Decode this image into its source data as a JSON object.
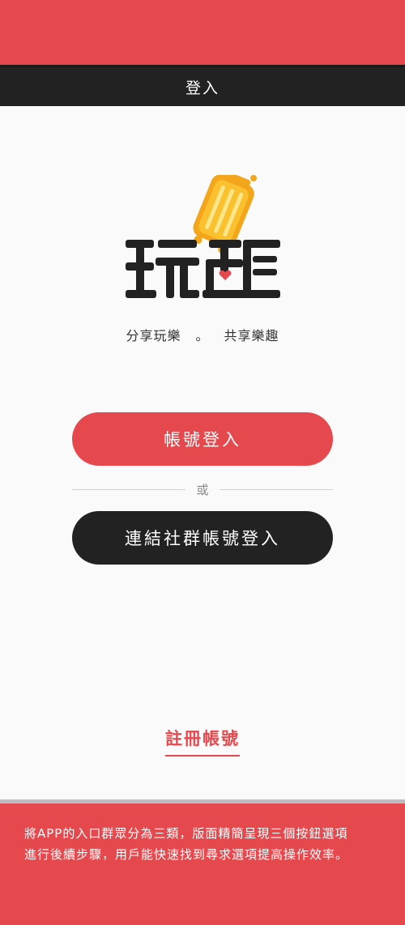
{
  "navbar": {
    "title": "登入"
  },
  "logo": {
    "brand_text": "玩趣",
    "icon": "suitcase-icon"
  },
  "slogan": {
    "left": "分享玩樂",
    "separator": "。",
    "right": "共享樂趣"
  },
  "buttons": {
    "account_login": "帳號登入",
    "divider_or": "或",
    "social_login": "連結社群帳號登入"
  },
  "register": {
    "label": "註冊帳號"
  },
  "caption": {
    "line1": "將APP的入口群眾分為三類，版面精簡呈現三個按鈕選項",
    "line2": "進行後續步驟，用戶能快速找到尋求選項提高操作效率。"
  },
  "colors": {
    "accent": "#e5484d",
    "dark": "#222222",
    "screen_bg": "#fafafa"
  }
}
